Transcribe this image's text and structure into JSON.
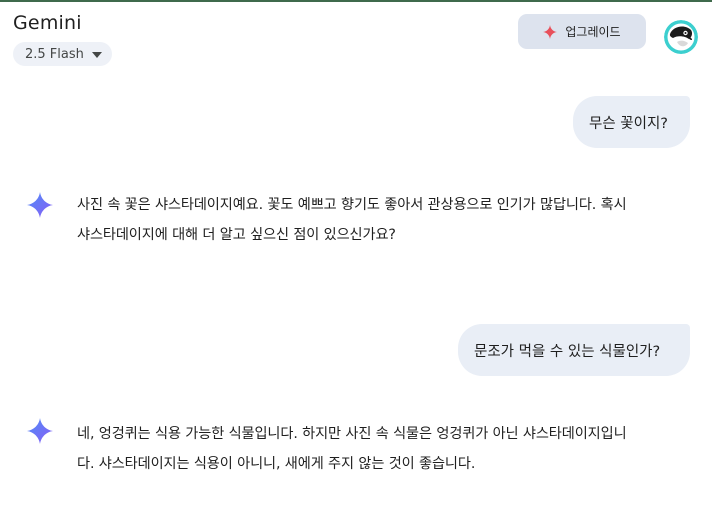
{
  "header": {
    "app_title": "Gemini",
    "model_label": "2.5 Flash",
    "upgrade_label": "업그레이드"
  },
  "conversation": [
    {
      "role": "user",
      "text": "무슨 꽃이지?"
    },
    {
      "role": "model",
      "lines": [
        "사진 속 꽃은 샤스타데이지예요. 꽃도 예쁘고 향기도 좋아서 관상용으로 인기가 많답니다. 혹시",
        "샤스타데이지에 대해 더 알고 싶으신 점이 있으신가요?"
      ]
    },
    {
      "role": "user",
      "text": "문조가 먹을 수 있는 식물인가?"
    },
    {
      "role": "model",
      "lines": [
        "네, 엉겅퀴는 식용 가능한 식물입니다. 하지만 사진 속 식물은 엉겅퀴가 아닌 샤스타데이지입니",
        "다. 샤스타데이지는 식용이 아니니, 새에게 주지 않는 것이 좋습니다."
      ]
    }
  ],
  "colors": {
    "user_bubble": "#e9eef6",
    "upgrade_button": "#dde3ee",
    "model_selector": "#eef1f7",
    "upgrade_sparkle": "#e8505b",
    "gemini_sparkle_start": "#4f8df7",
    "gemini_sparkle_end": "#8a5cf6",
    "avatar_ring": "#3ccfcf"
  },
  "icons": {
    "model_caret": "caret-down-icon",
    "upgrade": "sparkle-icon",
    "gemini_avatar": "gemini-sparkle-icon",
    "user_avatar": "user-avatar"
  }
}
